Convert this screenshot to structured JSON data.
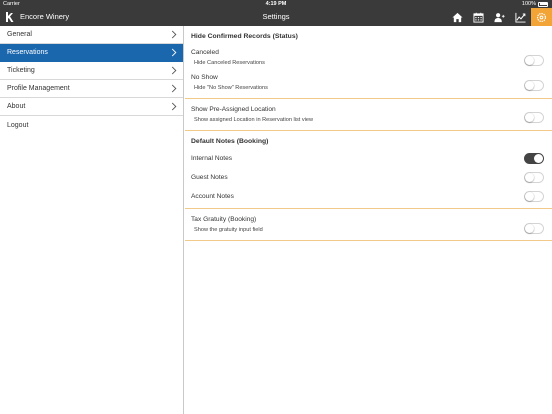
{
  "status_bar": {
    "carrier": "Carrier",
    "time": "4:19 PM",
    "battery": "100%"
  },
  "nav": {
    "app_name": "Encore Winery",
    "title": "Settings",
    "icons": [
      "home-icon",
      "calendar-icon",
      "user-add-icon",
      "chart-icon",
      "settings-icon"
    ],
    "active_icon": "settings-icon",
    "accent": "#f3a437",
    "bar_color": "#3a3a3a"
  },
  "sidebar": {
    "selected_color": "#1b67ad",
    "items": [
      {
        "label": "General"
      },
      {
        "label": "Reservations"
      },
      {
        "label": "Ticketing"
      },
      {
        "label": "Profile Management"
      },
      {
        "label": "About"
      }
    ],
    "selected_index": 1,
    "logout_label": "Logout"
  },
  "settings": {
    "hide_confirmed": {
      "header": "Hide Confirmed Records (Status)",
      "canceled": {
        "title": "Canceled",
        "subtitle": "Hide Canceled Reservations",
        "on": false
      },
      "no_show": {
        "title": "No Show",
        "subtitle": "Hide \"No Show\" Reservations",
        "on": false
      }
    },
    "pre_assigned": {
      "title": "Show Pre-Assigned Location",
      "subtitle": "Show assigned Location in Reservation list view",
      "on": false
    },
    "default_notes": {
      "header": "Default Notes (Booking)",
      "internal": {
        "title": "Internal Notes",
        "on": true
      },
      "guest": {
        "title": "Guest Notes",
        "on": false
      },
      "account": {
        "title": "Account Notes",
        "on": false
      }
    },
    "tax_gratuity": {
      "title": "Tax Gratuity (Booking)",
      "subtitle": "Show the gratuity input field",
      "on": false
    }
  }
}
